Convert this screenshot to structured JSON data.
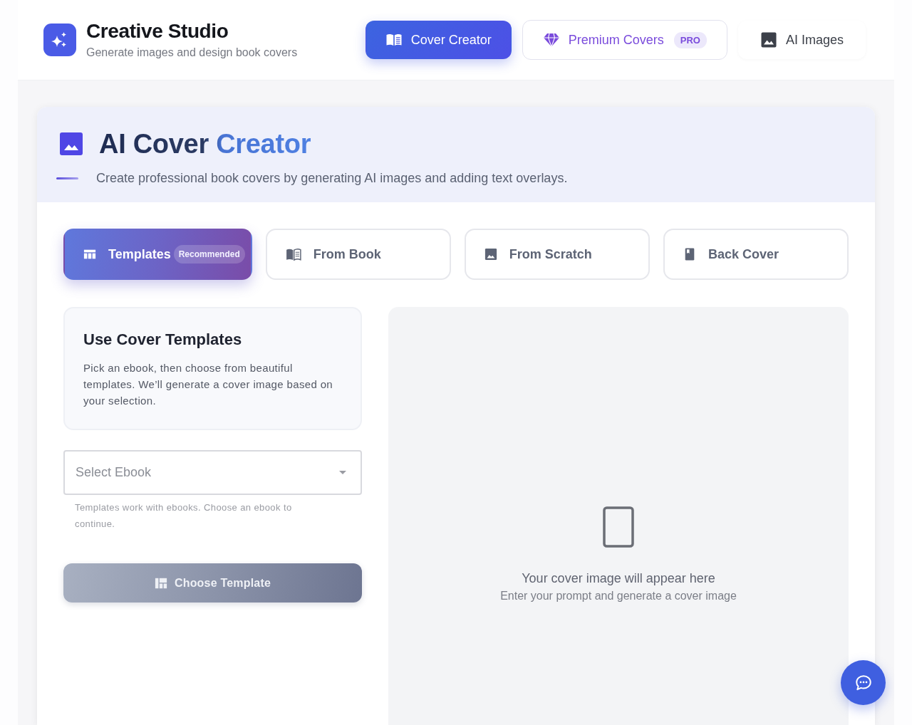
{
  "app": {
    "title": "Creative Studio",
    "subtitle": "Generate images and design book covers"
  },
  "nav_tabs": [
    {
      "label": "Cover Creator",
      "kind": "standard",
      "selected": true
    },
    {
      "label": "Premium Covers",
      "kind": "premium",
      "badge": "PRO",
      "selected": false
    },
    {
      "label": "AI Images",
      "kind": "standard",
      "selected": false
    }
  ],
  "page_header": {
    "title": "AI Cover Creator",
    "subtitle": "Create professional book covers by generating AI images and adding text overlays."
  },
  "mode_tabs": [
    {
      "label": "Templates",
      "badge": "Recommended",
      "selected": true
    },
    {
      "label": "From Book",
      "selected": false
    },
    {
      "label": "From Scratch",
      "selected": false
    },
    {
      "label": "Back Cover",
      "selected": false
    }
  ],
  "info_card": {
    "title": "Use Cover Templates",
    "text": "Pick an ebook, then choose from beautiful templates. We’ll generate a cover image based on your selection."
  },
  "ebook_select": {
    "placeholder": "Select Ebook",
    "helper": "Templates work with ebooks. Choose an ebook to continue."
  },
  "choose_button": {
    "label": "Choose Template",
    "disabled": true
  },
  "preview": {
    "title": "Your cover image will appear here",
    "hint": "Enter your prompt and generate a cover image"
  }
}
